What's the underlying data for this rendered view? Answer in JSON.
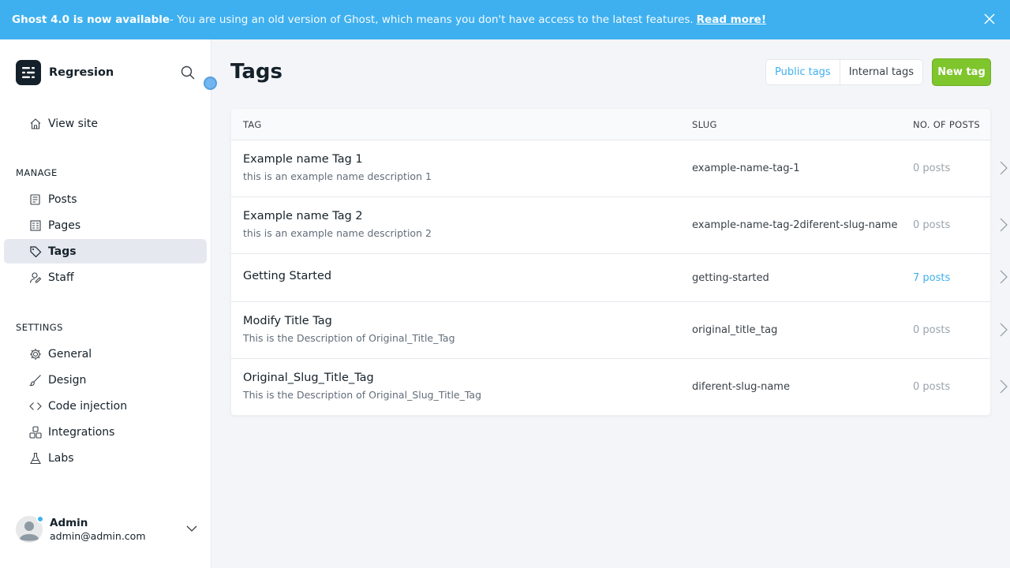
{
  "banner": {
    "headline": "Ghost 4.0 is now available",
    "message": " - You are using an old version of Ghost, which means you don't have access to the latest features.",
    "link": "Read more!"
  },
  "sidebar": {
    "site_name": "Regresion",
    "view_site": "View site",
    "manage_label": "MANAGE",
    "manage_items": [
      {
        "label": "Posts",
        "icon": "posts-icon"
      },
      {
        "label": "Pages",
        "icon": "pages-icon"
      },
      {
        "label": "Tags",
        "icon": "tag-icon",
        "active": true
      },
      {
        "label": "Staff",
        "icon": "staff-icon"
      }
    ],
    "settings_label": "SETTINGS",
    "settings_items": [
      {
        "label": "General",
        "icon": "gear-icon"
      },
      {
        "label": "Design",
        "icon": "brush-icon"
      },
      {
        "label": "Code injection",
        "icon": "code-icon"
      },
      {
        "label": "Integrations",
        "icon": "integrations-icon"
      },
      {
        "label": "Labs",
        "icon": "flask-icon"
      }
    ],
    "user": {
      "name": "Admin",
      "email": "admin@admin.com"
    }
  },
  "main": {
    "title": "Tags",
    "filter_public": "Public tags",
    "filter_internal": "Internal tags",
    "new_tag": "New tag",
    "columns": {
      "tag": "TAG",
      "slug": "SLUG",
      "posts": "NO. OF POSTS"
    },
    "rows": [
      {
        "name": "Example name Tag 1",
        "description": "this is an example name description 1",
        "slug": "example-name-tag-1",
        "posts": "0 posts"
      },
      {
        "name": "Example name Tag 2",
        "description": "this is an example name description 2",
        "slug": "example-name-tag-2diferent-slug-name",
        "posts": "0 posts"
      },
      {
        "name": "Getting Started",
        "description": "",
        "slug": "getting-started",
        "posts": "7 posts"
      },
      {
        "name": "Modify Title Tag",
        "description": "This is the Description of Original_Title_Tag",
        "slug": "original_title_tag",
        "posts": "0 posts"
      },
      {
        "name": "Original_Slug_Title_Tag",
        "description": "This is the Description of Original_Slug_Title_Tag",
        "slug": "diferent-slug-name",
        "posts": "0 posts"
      }
    ]
  },
  "colors": {
    "accent": "#3eb0ef",
    "primary_button": "#7fc52c",
    "sidebar_active": "#e5e9ef"
  }
}
